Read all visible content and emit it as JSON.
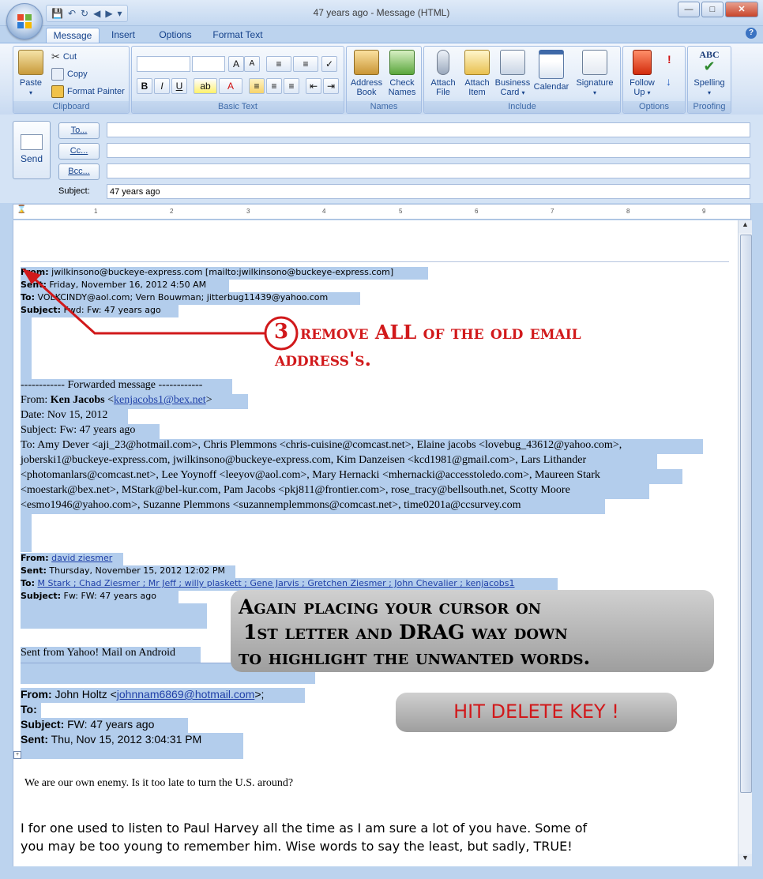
{
  "window": {
    "title": "47 years ago - Message (HTML)"
  },
  "tabs": [
    "Message",
    "Insert",
    "Options",
    "Format Text"
  ],
  "ribbon": {
    "clipboard": {
      "label": "Clipboard",
      "paste": "Paste",
      "cut": "Cut",
      "copy": "Copy",
      "format_painter": "Format Painter"
    },
    "basic_text": {
      "label": "Basic Text"
    },
    "names": {
      "label": "Names",
      "address_book": [
        "Address",
        "Book"
      ],
      "check_names": [
        "Check",
        "Names"
      ]
    },
    "include": {
      "label": "Include",
      "attach_file": [
        "Attach",
        "File"
      ],
      "attach_item": [
        "Attach",
        "Item"
      ],
      "business_card": [
        "Business",
        "Card"
      ],
      "calendar": "Calendar",
      "signature": "Signature"
    },
    "options": {
      "label": "Options",
      "follow_up": [
        "Follow",
        "Up"
      ]
    },
    "proofing": {
      "label": "Proofing",
      "spelling": "Spelling",
      "abc": "ABC"
    }
  },
  "header": {
    "send": "Send",
    "to_btn": "To...",
    "cc_btn": "Cc...",
    "bcc_btn": "Bcc...",
    "subject_label": "Subject:",
    "subject_value": "47 years ago"
  },
  "ruler_numbers": [
    "1",
    "2",
    "3",
    "4",
    "5",
    "6",
    "7",
    "8",
    "9"
  ],
  "message": {
    "hdr1": {
      "from_label": "From:",
      "from_value": " jwilkinsono@buckeye-express.com [mailto:jwilkinsono@buckeye-express.com]",
      "sent_label": "Sent:",
      "sent_value": " Friday, November 16, 2012 4:50 AM",
      "to_label": "To:",
      "to_value": " VOLKCINDY@aol.com; Vern Bouwman; jitterbug11439@yahoo.com",
      "subject_label": "Subject:",
      "subject_value": " Fwd: Fw: 47 years ago"
    },
    "forwarded": "------------ Forwarded message ------------",
    "fwd_from_label": "From: ",
    "fwd_from_name": "Ken Jacobs",
    "fwd_from_email": "kenjacobs1@bex.net",
    "fwd_date": "Date: Nov 15, 2012",
    "fwd_subject": "Subject: Fw: 47 years ago",
    "fwd_to_1": "To: Amy Dever <aji_23@hotmail.com>, Chris Plemmons <chris-cuisine@comcast.net>, Elaine jacobs <lovebug_43612@yahoo.com>,",
    "fwd_to_2": "joberski1@buckeye-express.com, jwilkinsono@buckeye-express.com, Kim Danzeisen <kcd1981@gmail.com>, Lars Lithander",
    "fwd_to_3": "<photomanlars@comcast.net>, Lee Yoynoff <leeyov@aol.com>, Mary Hernacki <mhernacki@accesstoledo.com>, Maureen Stark",
    "fwd_to_4": "<moestark@bex.net>, MStark@bel-kur.com, Pam Jacobs <pkj811@frontier.com>, rose_tracy@bellsouth.net, Scotty Moore",
    "fwd_to_5": "<esmo1946@yahoo.com>, Suzanne Plemmons <suzannemplemmons@comcast.net>, time0201a@ccsurvey.com",
    "hdr2": {
      "from_label": "From:",
      "from_value": "david ziesmer",
      "sent_label": "Sent:",
      "sent_value": " Thursday, November 15, 2012 12:02 PM",
      "to_label": "To:",
      "to_value": "M Stark ; Chad Ziesmer ; Mr Jeff ; willy plaskett ; Gene Jarvis ; Gretchen Ziesmer ; John Chevalier ; kenjacobs1",
      "subject_label": "Subject:",
      "subject_value": " Fw: FW: 47 years ago"
    },
    "yahoo": "Sent from Yahoo! Mail on Android",
    "hdr3": {
      "from_label": "From:",
      "from_name": " John Holtz <",
      "from_email": "johnnam6869@hotmail.com",
      "from_tail": ">;",
      "to_label": "To:",
      "subject_label": "Subject:",
      "subject_value": " FW: 47 years ago",
      "sent_label": "Sent:",
      "sent_value": " Thu, Nov 15, 2012 3:04:31 PM"
    },
    "enemy": "We are our own enemy. Is it too late to turn the U.S. around?",
    "harvey_1": "I for one used to listen to Paul Harvey all the time as I am sure a lot of you have.  Some of",
    "harvey_2": "you may be too young to remember him.  Wise words to say the least, but sadly, TRUE!"
  },
  "annotations": {
    "step_number": "3",
    "step_line1": "remove ALL of the old email",
    "step_line2": "address's.",
    "cursor_line1": "Again placing your cursor on",
    "cursor_line2": "1st letter and DRAG way down",
    "cursor_line3": "to highlight the unwanted words.",
    "delete": "HIT DELETE KEY !"
  }
}
